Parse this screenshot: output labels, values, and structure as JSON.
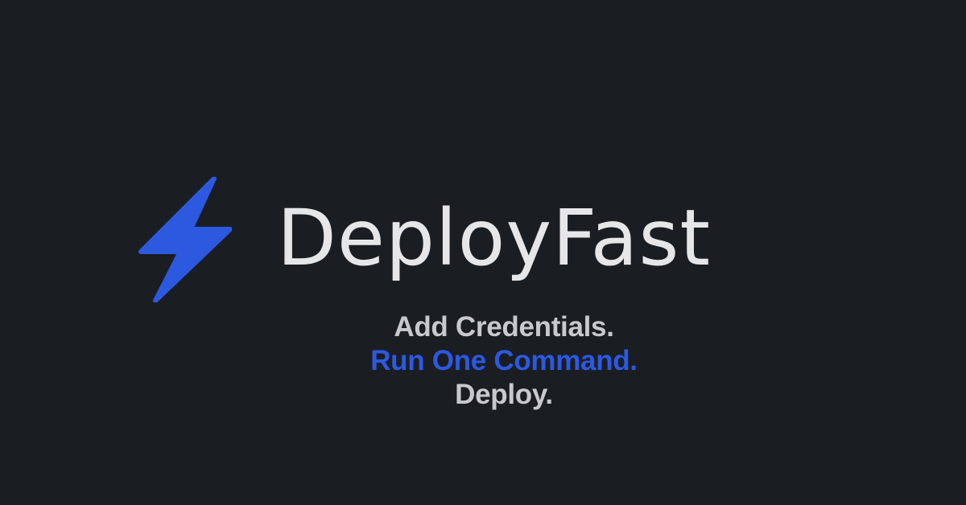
{
  "brand": {
    "name": "DeployFast",
    "icon": "lightning-bolt-icon",
    "accent_color": "#2d58e0",
    "text_color": "#e6e6e8"
  },
  "tagline": {
    "line1": "Add Credentials.",
    "line2": "Run One Command.",
    "line3": "Deploy."
  },
  "background_color": "#1a1e23"
}
